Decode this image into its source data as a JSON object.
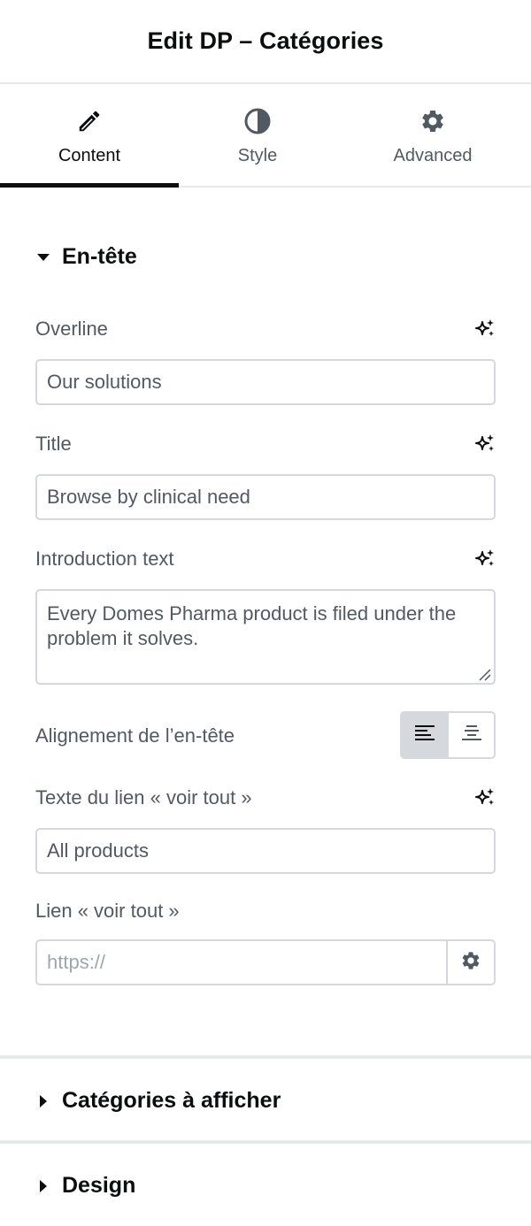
{
  "header": {
    "title": "Edit DP – Catégories"
  },
  "tabs": [
    {
      "label": "Content",
      "icon": "pencil-icon",
      "active": true
    },
    {
      "label": "Style",
      "icon": "half-circle-icon",
      "active": false
    },
    {
      "label": "Advanced",
      "icon": "gear-icon",
      "active": false
    }
  ],
  "section_header": {
    "title": "En-tête",
    "expanded": true
  },
  "fields": {
    "overline": {
      "label": "Overline",
      "value": "Our solutions"
    },
    "title": {
      "label": "Title",
      "value": "Browse by clinical need"
    },
    "intro": {
      "label": "Introduction text",
      "value": "Every Domes Pharma product is filed under the problem it solves."
    },
    "alignment": {
      "label": "Alignement de l’en-tête",
      "options": [
        "align-left-icon",
        "align-center-icon"
      ],
      "selected": "align-left-icon"
    },
    "see_all_text": {
      "label": "Texte du lien « voir tout »",
      "value": "All products"
    },
    "see_all_link": {
      "label": "Lien « voir tout »",
      "placeholder": "https://",
      "value": ""
    }
  },
  "collapsed_sections": [
    {
      "title": "Catégories à afficher",
      "expanded": false
    },
    {
      "title": "Design",
      "expanded": false
    }
  ],
  "colors": {
    "text_dark": "#0c0d0e",
    "text_muted": "#515962",
    "border": "#d5d8dc",
    "active_tab_bar": "#0c0d0e"
  }
}
